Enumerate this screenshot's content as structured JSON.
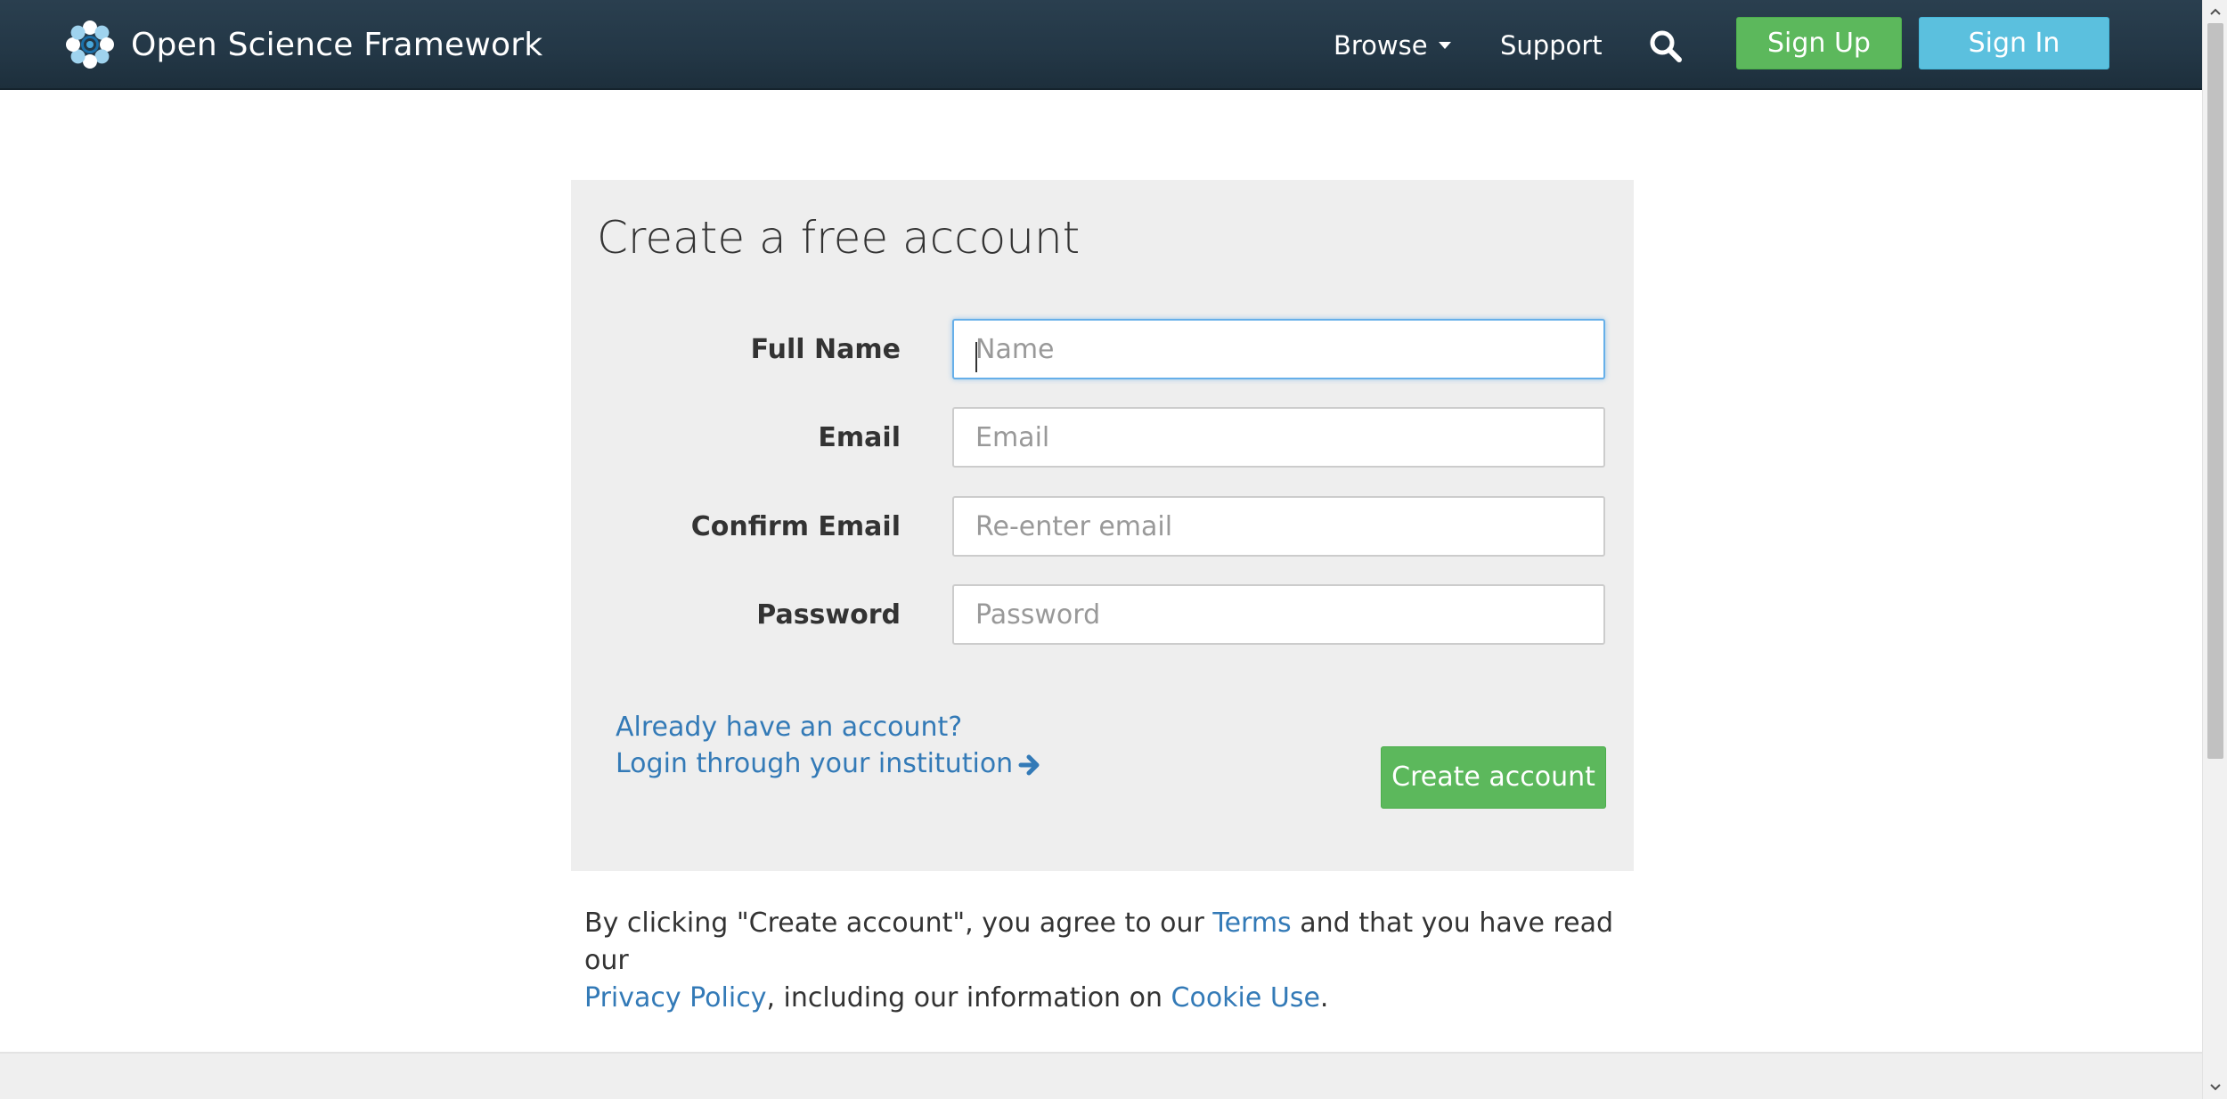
{
  "navbar": {
    "brand_name": "Open Science Framework",
    "browse_label": "Browse",
    "support_label": "Support",
    "signup_label": "Sign Up",
    "signin_label": "Sign In"
  },
  "form": {
    "title": "Create a free account",
    "fields": [
      {
        "label": "Full Name",
        "placeholder": "Name",
        "value": ""
      },
      {
        "label": "Email",
        "placeholder": "Email",
        "value": ""
      },
      {
        "label": "Confirm Email",
        "placeholder": "Re-enter email",
        "value": ""
      },
      {
        "label": "Password",
        "placeholder": "Password",
        "value": ""
      }
    ],
    "already_account_link": "Already have an account?",
    "institution_link": "Login through your institution",
    "create_button": "Create account"
  },
  "legal": {
    "part1": "By clicking \"Create account\", you agree to our ",
    "terms_link": "Terms",
    "part2": " and that you have read our",
    "privacy_link": "Privacy Policy",
    "part3": ", including our information on ",
    "cookie_link": "Cookie Use",
    "part4": "."
  },
  "colors": {
    "navbar": "#233746",
    "success_green": "#5cb85c",
    "info_blue": "#5bc0de",
    "link_blue": "#337ab7",
    "panel_gray": "#eeeeee"
  },
  "icons": [
    "osf-logo-icon",
    "caret-down-icon",
    "search-icon",
    "arrow-right-icon",
    "scroll-up-icon",
    "scroll-down-icon"
  ]
}
